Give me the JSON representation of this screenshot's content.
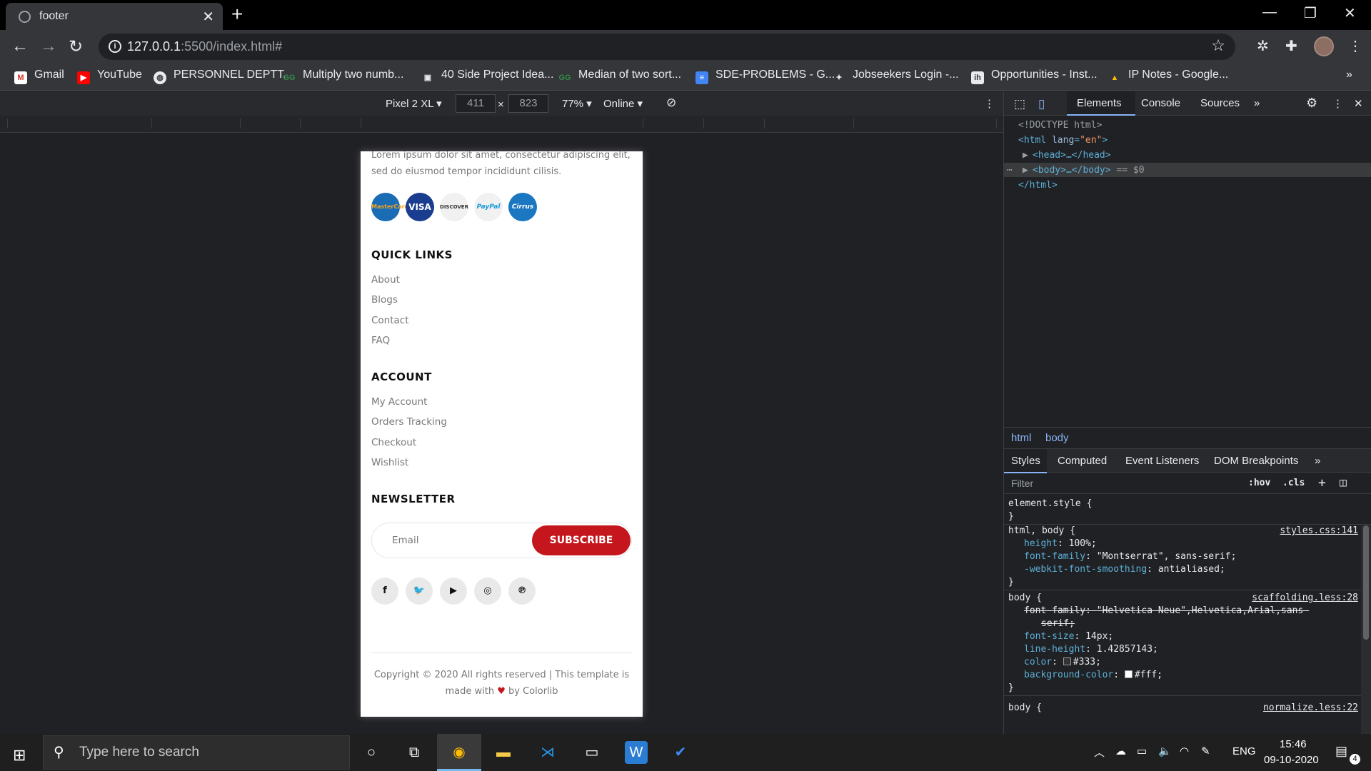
{
  "browser": {
    "tab_title": "footer",
    "url_host": "127.0.0.1",
    "url_path": ":5500/index.html#",
    "bookmarks": [
      "Gmail",
      "YouTube",
      "PERSONNEL DEPTT.",
      "Multiply two numb...",
      "40 Side Project Idea...",
      "Median of two sort...",
      "SDE-PROBLEMS - G...",
      "Jobseekers Login -...",
      "Opportunities - Inst...",
      "IP Notes - Google..."
    ]
  },
  "device_toolbar": {
    "device": "Pixel 2 XL",
    "width": "411",
    "height": "823",
    "times": "×",
    "zoom": "77%",
    "network": "Online"
  },
  "page": {
    "description": "Lorem ipsum dolor sit amet, consectetur adipiscing elit, sed do eiusmod tempor incididunt cilisis.",
    "payment_cards": [
      "MasterCard",
      "VISA",
      "DISCOVER",
      "PayPal",
      "Cirrus"
    ],
    "quick_links_heading": "QUICK LINKS",
    "quick_links": [
      "About",
      "Blogs",
      "Contact",
      "FAQ"
    ],
    "account_heading": "ACCOUNT",
    "account_links": [
      "My Account",
      "Orders Tracking",
      "Checkout",
      "Wishlist"
    ],
    "newsletter_heading": "NEWSLETTER",
    "email_placeholder": "Email",
    "subscribe_label": "SUBSCRIBE",
    "copyright_line1": "Copyright © 2020 All rights reserved | This template is",
    "copyright_made": "made with",
    "copyright_by": "by Colorlib"
  },
  "devtools": {
    "tabs": [
      "Elements",
      "Console",
      "Sources"
    ],
    "dom": {
      "doctype": "<!DOCTYPE html>",
      "html_open": "<html",
      "lang_attr": "lang",
      "lang_val": "\"en\"",
      "head": "<head>…</head>",
      "body": "<body>…</body>",
      "body_ref": "== $0",
      "html_close": "</html>"
    },
    "breadcrumbs": [
      "html",
      "body"
    ],
    "styles_tabs": [
      "Styles",
      "Computed",
      "Event Listeners",
      "DOM Breakpoints"
    ],
    "filter_placeholder": "Filter",
    "hov": ":hov",
    "cls": ".cls",
    "rules": {
      "element_style": "element.style {",
      "r1_selector": "html, body {",
      "r1_source": "styles.css:141",
      "r1_props": [
        [
          "height",
          "100%;"
        ],
        [
          "font-family",
          "\"Montserrat\", sans-serif;"
        ],
        [
          "-webkit-font-smoothing",
          "antialiased;"
        ]
      ],
      "r2_selector": "body {",
      "r2_source": "scaffolding.less:28",
      "r2_strike_prop": "font-family",
      "r2_strike_val": "\"Helvetica Neue\",Helvetica,Arial,sans-",
      "r2_strike_cont": "serif;",
      "r2_props": [
        [
          "font-size",
          "14px;"
        ],
        [
          "line-height",
          "1.42857143;"
        ],
        [
          "color",
          "#333;"
        ],
        [
          "background-color",
          "#fff;"
        ]
      ],
      "r3_selector": "body {",
      "r3_source": "normalize.less:22",
      "close_brace": "}"
    }
  },
  "taskbar": {
    "search_placeholder": "Type here to search",
    "language": "ENG",
    "time": "15:46",
    "date": "09-10-2020",
    "notifications": "4"
  },
  "colors": {
    "accent_red": "#c4161c",
    "devtools_blue": "#8ab4f8"
  }
}
